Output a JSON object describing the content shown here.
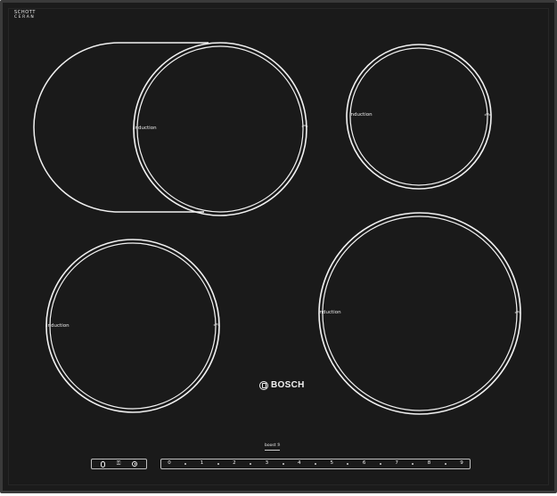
{
  "manufacturer_mark": {
    "line1": "SCHOTT",
    "line2": "CERAN",
    "line3": "(not legible)"
  },
  "brand": {
    "name": "BOSCH"
  },
  "zones": [
    {
      "label": "induction",
      "chevron": "︽"
    },
    {
      "label": "induction",
      "chevron": "︽"
    },
    {
      "label": "induction",
      "chevron": "︽"
    },
    {
      "label": "induction",
      "chevron": "︽"
    }
  ],
  "controls": {
    "boost_label": "boost",
    "boost_symbol": "ℬ",
    "power_label": "",
    "lock_label": "⚿",
    "timer_label": "",
    "power_levels": [
      "0",
      "1",
      "2",
      "3",
      "4",
      "5",
      "6",
      "7",
      "8",
      "9"
    ]
  },
  "colors": {
    "glass": "#1a1a1a",
    "frame": "#3a3a3a",
    "markings": "#f2f2f2"
  },
  "icons": {
    "power": "power-icon",
    "child_lock": "child-lock-icon",
    "timer": "clock-icon",
    "brand": "bosch-logo-icon"
  }
}
